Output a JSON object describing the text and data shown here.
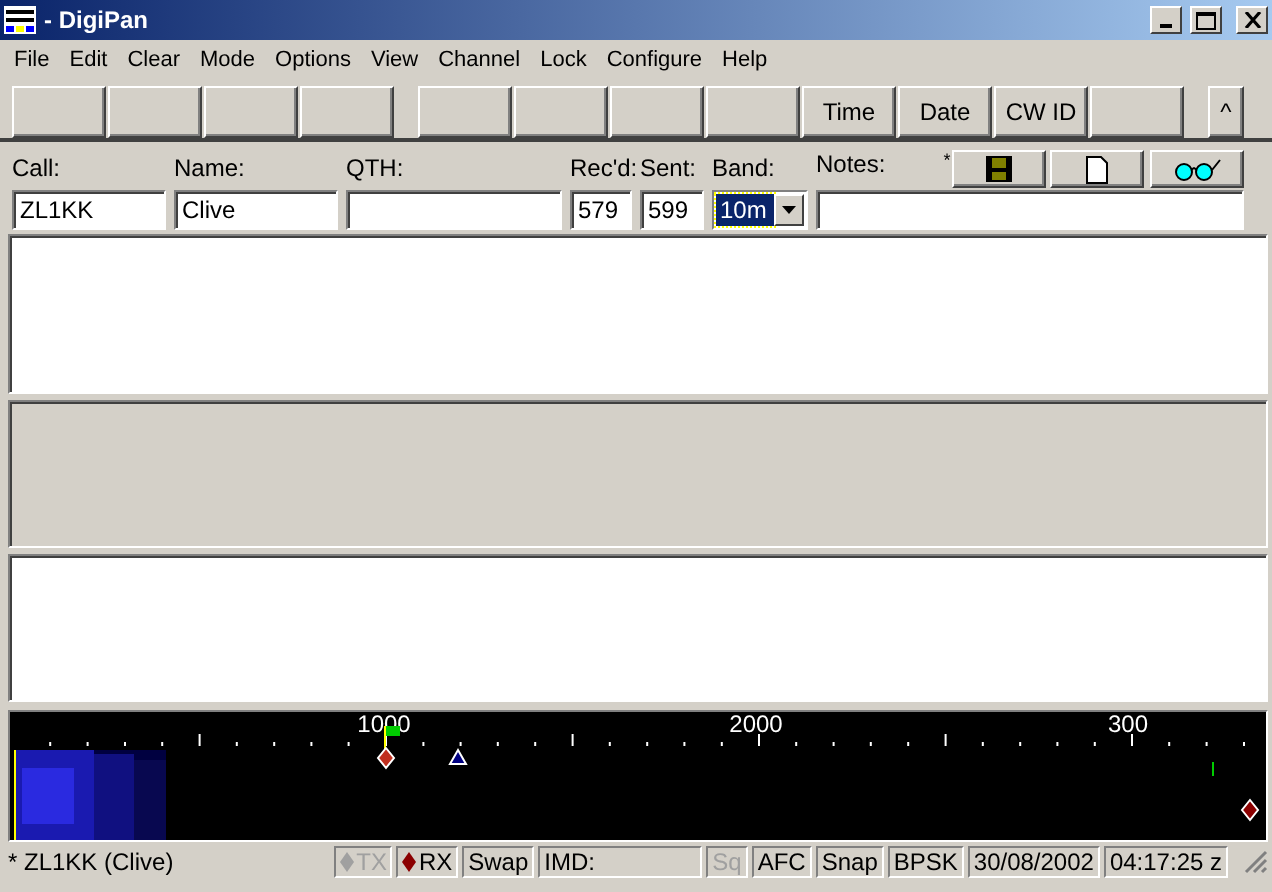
{
  "window": {
    "title": "- DigiPan"
  },
  "menu": [
    "File",
    "Edit",
    "Clear",
    "Mode",
    "Options",
    "View",
    "Channel",
    "Lock",
    "Configure",
    "Help"
  ],
  "toolbar": [
    {
      "kind": "blank"
    },
    {
      "kind": "blank"
    },
    {
      "kind": "blank"
    },
    {
      "kind": "blank"
    },
    {
      "kind": "gap"
    },
    {
      "kind": "blank"
    },
    {
      "kind": "blank"
    },
    {
      "kind": "blank"
    },
    {
      "kind": "blank"
    },
    {
      "kind": "text",
      "label": "Time"
    },
    {
      "kind": "text",
      "label": "Date"
    },
    {
      "kind": "text",
      "label": "CW ID"
    },
    {
      "kind": "blank"
    },
    {
      "kind": "gap"
    },
    {
      "kind": "text",
      "label": "^"
    }
  ],
  "log": {
    "fields": [
      {
        "label": "Call:",
        "value": "ZL1KK",
        "kind": "text"
      },
      {
        "label": "Name:",
        "value": "Clive",
        "kind": "text"
      },
      {
        "label": "QTH:",
        "kind": "text"
      },
      {
        "label": "Rec'd:",
        "value": "579",
        "kind": "text"
      },
      {
        "label": "Sent:",
        "value": "599",
        "kind": "text"
      },
      {
        "label": "Band:",
        "value": "10m",
        "kind": "select"
      },
      {
        "label": "Notes:",
        "kind": "text"
      }
    ],
    "mark": "*",
    "buttons": [
      {
        "kind": "save"
      },
      {
        "kind": "new"
      },
      {
        "kind": "find"
      }
    ]
  },
  "waterfall": {
    "scale_labels": [
      "1000",
      "2000",
      "300"
    ]
  },
  "status_bar": {
    "text": "* ZL1KK (Clive)",
    "items": [
      {
        "label": "TX",
        "kind": "diamond",
        "disabled": true
      },
      {
        "label": "RX",
        "kind": "diamond",
        "disabled": false
      },
      {
        "label": "Swap",
        "kind": "plain",
        "disabled": false
      },
      {
        "label": "IMD:",
        "kind": "wide",
        "disabled": false
      },
      {
        "label": "Sq",
        "kind": "plain",
        "disabled": true
      },
      {
        "label": "AFC",
        "kind": "plain",
        "disabled": false
      },
      {
        "label": "Snap",
        "kind": "plain",
        "disabled": false
      },
      {
        "label": "BPSK",
        "kind": "plain",
        "disabled": false
      },
      {
        "label": "30/08/2002",
        "kind": "plain",
        "disabled": false
      },
      {
        "label": "04:17:25 z",
        "kind": "plain",
        "disabled": false
      }
    ]
  }
}
